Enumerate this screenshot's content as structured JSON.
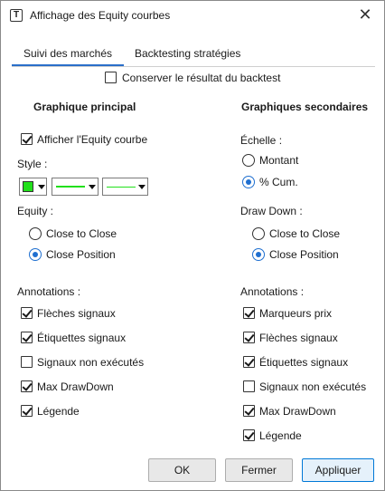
{
  "window": {
    "title": "Affichage des Equity courbes",
    "icon": "T",
    "close_symbol": "✕"
  },
  "tabs": [
    {
      "label": "Suivi des marchés",
      "active": true
    },
    {
      "label": "Backtesting stratégies",
      "active": false
    }
  ],
  "keep_backtest": {
    "label": "Conserver le résultat du backtest",
    "checked": false
  },
  "main_chart": {
    "heading": "Graphique principal",
    "show_equity": {
      "label": "Afficher l'Equity courbe",
      "checked": true
    },
    "style_label": "Style :",
    "style_color": "#22e01b",
    "equity_label": "Equity :",
    "equity_options": [
      {
        "label": "Close to Close",
        "selected": false
      },
      {
        "label": "Close Position",
        "selected": true
      }
    ],
    "annotations_label": "Annotations :",
    "annotations": [
      {
        "label": "Flèches signaux",
        "checked": true
      },
      {
        "label": "Étiquettes signaux",
        "checked": true
      },
      {
        "label": "Signaux non exécutés",
        "checked": false
      },
      {
        "label": "Max DrawDown",
        "checked": true
      },
      {
        "label": "Légende",
        "checked": true
      }
    ]
  },
  "secondary_charts": {
    "heading": "Graphiques secondaires",
    "scale_label": "Échelle :",
    "scale_options": [
      {
        "label": "Montant",
        "selected": false
      },
      {
        "label": "% Cum.",
        "selected": true
      }
    ],
    "drawdown_label": "Draw Down :",
    "drawdown_options": [
      {
        "label": "Close to Close",
        "selected": false
      },
      {
        "label": "Close Position",
        "selected": true
      }
    ],
    "annotations_label": "Annotations :",
    "annotations": [
      {
        "label": "Marqueurs prix",
        "checked": true
      },
      {
        "label": "Flèches signaux",
        "checked": true
      },
      {
        "label": "Étiquettes signaux",
        "checked": true
      },
      {
        "label": "Signaux non exécutés",
        "checked": false
      },
      {
        "label": "Max DrawDown",
        "checked": true
      },
      {
        "label": "Légende",
        "checked": true
      }
    ]
  },
  "buttons": {
    "ok": "OK",
    "close": "Fermer",
    "apply": "Appliquer"
  }
}
